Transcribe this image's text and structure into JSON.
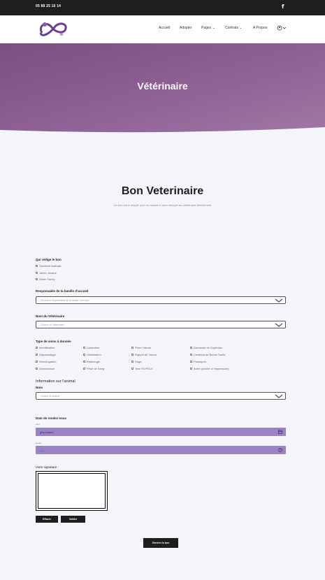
{
  "topbar": {
    "phone": "05 88 25 16 14",
    "social_icon": "f"
  },
  "nav": {
    "items": [
      {
        "label": "Accueil"
      },
      {
        "label": "Adopter"
      },
      {
        "label": "Pages",
        "chevron": true
      },
      {
        "label": "Contrats",
        "chevron": true
      },
      {
        "label": "A Propos"
      }
    ],
    "account_icon": "user-circle-icon"
  },
  "hero": {
    "title": "Vétérinaire"
  },
  "form": {
    "title": "Bon Veterinaire",
    "subtitle": "Ce bon est à remplir pour un animal et sera envoyer au vétérinaire directement",
    "redige": {
      "label": "Qui rédige le bon",
      "options": [
        "Gambioli Nathalie",
        "Jamin Josane",
        "Didier Fanny"
      ]
    },
    "responsable": {
      "label": "Responsable de la famille d'accueil",
      "placeholder": "Choisis le responsable de la famille d'accueil"
    },
    "veterinaire": {
      "label": "Nom du Vétérinaire",
      "placeholder": "Choisir un Vétérinaire"
    },
    "soins": {
      "label": "Type de soins à donnée",
      "col1": [
        "Identification",
        "Déparasitage",
        "Vermifugation",
        "Ordonnance"
      ],
      "col2": [
        "Castration",
        "Stérilisation",
        "Radiologie",
        "Prise de Sang"
      ],
      "col3": [
        "Primo Vaccin",
        "Rappel de Vaccin",
        "Rage",
        "Test FIV/FELV"
      ],
      "col4": [
        "Demande de Duplicata",
        "Certificat de Bonne Santé",
        "Passeport",
        "Autre (Arbitre à l'impression)"
      ]
    },
    "animal": {
      "section": "Information sur l'animal",
      "label": "Nom",
      "placeholder": "Choisir un animal"
    },
    "rdv": {
      "label": "Date de rendez-vous",
      "jour_label": "Jour",
      "jour_value": "jj/mm/aaaa",
      "heure_label": "Heure",
      "heure_value": "--:--"
    },
    "signature": {
      "label": "Votre signature :"
    },
    "buttons": {
      "clear": "Effacer",
      "validate": "Valider",
      "generate": "Générer le bon"
    }
  },
  "colors": {
    "accent": "#9b82c4",
    "hero": "#8d5f93",
    "dark": "#1e1e1e"
  }
}
